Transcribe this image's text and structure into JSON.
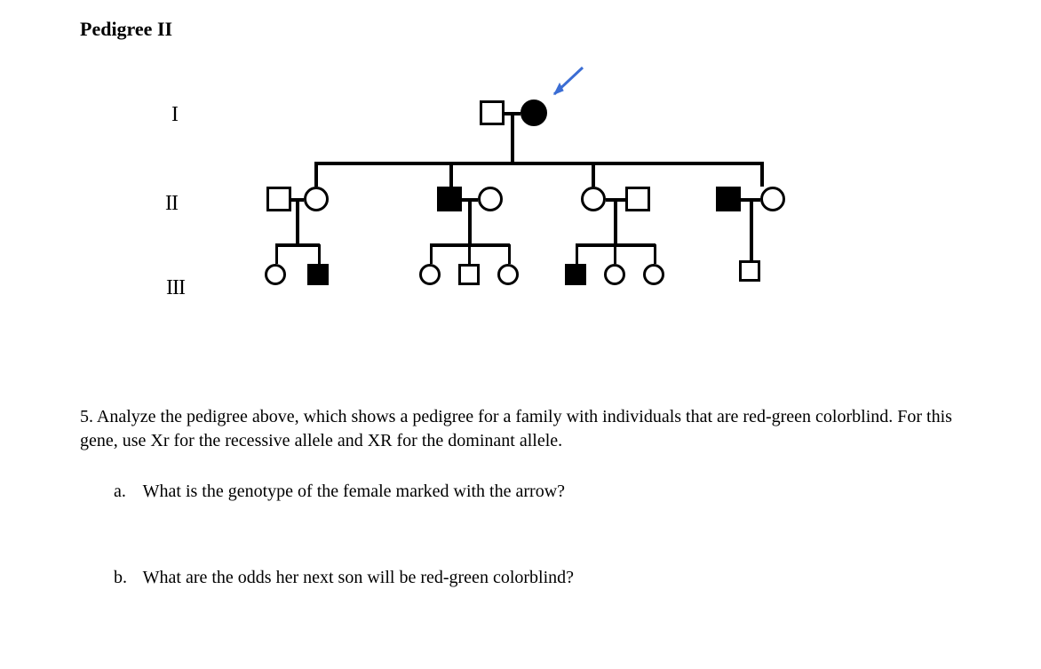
{
  "title": "Pedigree II",
  "generation_labels": {
    "g1": "I",
    "g2": "II",
    "g3": "III"
  },
  "question_number": "5.",
  "question_text": "Analyze the pedigree above, which shows a pedigree for a family with individuals that are red-green colorblind. For this gene, use Xr for the recessive allele and XR for the dominant allele.",
  "sub_a_letter": "a.",
  "sub_a_text": "What is the genotype of the female marked with the arrow?",
  "sub_b_letter": "b.",
  "sub_b_text": "What are the odds her next son will be red-green colorblind?",
  "chart_data": {
    "type": "pedigree",
    "alleles": {
      "recessive": "Xr",
      "dominant": "XR"
    },
    "arrow_points_to": "I-2",
    "individuals": [
      {
        "id": "I-1",
        "gen": 1,
        "sex": "male",
        "affected": false
      },
      {
        "id": "I-2",
        "gen": 1,
        "sex": "female",
        "affected": true,
        "proband_arrow": true
      },
      {
        "id": "II-1",
        "gen": 2,
        "sex": "male",
        "affected": false,
        "married_in": true
      },
      {
        "id": "II-2",
        "gen": 2,
        "sex": "female",
        "affected": false,
        "parents": [
          "I-1",
          "I-2"
        ]
      },
      {
        "id": "II-3",
        "gen": 2,
        "sex": "male",
        "affected": true,
        "parents": [
          "I-1",
          "I-2"
        ]
      },
      {
        "id": "II-4",
        "gen": 2,
        "sex": "female",
        "affected": false,
        "married_in": true
      },
      {
        "id": "II-5",
        "gen": 2,
        "sex": "female",
        "affected": false,
        "parents": [
          "I-1",
          "I-2"
        ]
      },
      {
        "id": "II-6",
        "gen": 2,
        "sex": "male",
        "affected": false,
        "married_in": true
      },
      {
        "id": "II-7",
        "gen": 2,
        "sex": "male",
        "affected": true,
        "parents": [
          "I-1",
          "I-2"
        ]
      },
      {
        "id": "II-8",
        "gen": 2,
        "sex": "female",
        "affected": false,
        "married_in": true
      },
      {
        "id": "III-1",
        "gen": 3,
        "sex": "female",
        "affected": false,
        "parents": [
          "II-1",
          "II-2"
        ]
      },
      {
        "id": "III-2",
        "gen": 3,
        "sex": "male",
        "affected": true,
        "parents": [
          "II-1",
          "II-2"
        ]
      },
      {
        "id": "III-3",
        "gen": 3,
        "sex": "female",
        "affected": false,
        "parents": [
          "II-3",
          "II-4"
        ]
      },
      {
        "id": "III-4",
        "gen": 3,
        "sex": "male",
        "affected": false,
        "parents": [
          "II-3",
          "II-4"
        ]
      },
      {
        "id": "III-5",
        "gen": 3,
        "sex": "female",
        "affected": false,
        "parents": [
          "II-3",
          "II-4"
        ]
      },
      {
        "id": "III-6",
        "gen": 3,
        "sex": "male",
        "affected": true,
        "parents": [
          "II-5",
          "II-6"
        ]
      },
      {
        "id": "III-7",
        "gen": 3,
        "sex": "female",
        "affected": false,
        "parents": [
          "II-5",
          "II-6"
        ]
      },
      {
        "id": "III-8",
        "gen": 3,
        "sex": "female",
        "affected": false,
        "parents": [
          "II-5",
          "II-6"
        ]
      },
      {
        "id": "III-9",
        "gen": 3,
        "sex": "male",
        "affected": false,
        "parents": [
          "II-7",
          "II-8"
        ]
      }
    ],
    "matings": [
      [
        "I-1",
        "I-2"
      ],
      [
        "II-1",
        "II-2"
      ],
      [
        "II-3",
        "II-4"
      ],
      [
        "II-5",
        "II-6"
      ],
      [
        "II-7",
        "II-8"
      ]
    ]
  }
}
